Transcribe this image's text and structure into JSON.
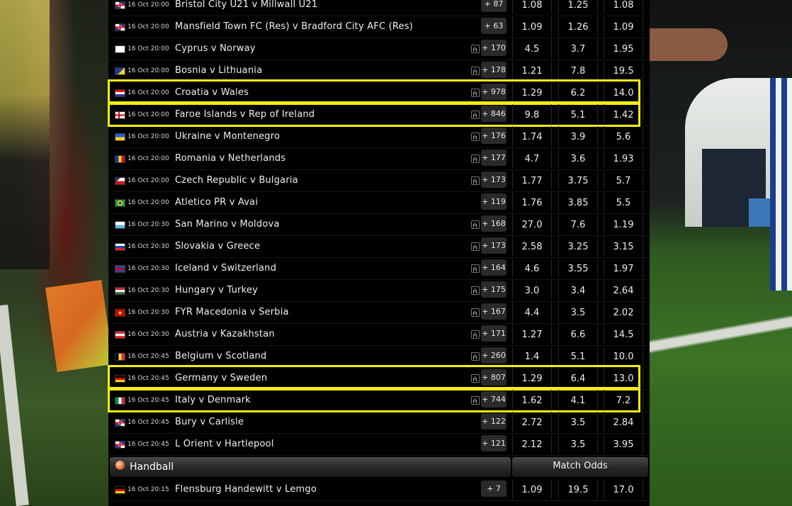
{
  "football_rows": [
    {
      "flag": "gb",
      "time": "16 Oct 20:00",
      "match": "Bristol City U21 v Millwall U21",
      "stats": false,
      "count": "+ 87",
      "odds": [
        "1.08",
        "1.25",
        "1.08"
      ]
    },
    {
      "flag": "gb",
      "time": "16 Oct 20:00",
      "match": "Mansfield Town FC (Res) v Bradford City AFC (Res)",
      "stats": false,
      "count": "+ 63",
      "odds": [
        "1.09",
        "1.26",
        "1.09"
      ]
    },
    {
      "flag": "cy",
      "time": "16 Oct 20:00",
      "match": "Cyprus v Norway",
      "stats": true,
      "count": "+ 170",
      "odds": [
        "4.5",
        "3.7",
        "1.95"
      ]
    },
    {
      "flag": "ba",
      "time": "16 Oct 20:00",
      "match": "Bosnia v Lithuania",
      "stats": true,
      "count": "+ 178",
      "odds": [
        "1.21",
        "7.8",
        "19.5"
      ]
    },
    {
      "flag": "hr",
      "time": "16 Oct 20:00",
      "match": "Croatia v Wales",
      "stats": true,
      "count": "+ 978",
      "odds": [
        "1.29",
        "6.2",
        "14.0"
      ],
      "highlight": true
    },
    {
      "flag": "fo",
      "time": "16 Oct 20:00",
      "match": "Faroe Islands v Rep of Ireland",
      "stats": true,
      "count": "+ 846",
      "odds": [
        "9.8",
        "5.1",
        "1.42"
      ],
      "highlight": true
    },
    {
      "flag": "ua",
      "time": "16 Oct 20:00",
      "match": "Ukraine v Montenegro",
      "stats": true,
      "count": "+ 176",
      "odds": [
        "1.74",
        "3.9",
        "5.6"
      ]
    },
    {
      "flag": "ro",
      "time": "16 Oct 20:00",
      "match": "Romania v Netherlands",
      "stats": true,
      "count": "+ 177",
      "odds": [
        "4.7",
        "3.6",
        "1.93"
      ]
    },
    {
      "flag": "cz",
      "time": "16 Oct 20:00",
      "match": "Czech Republic v Bulgaria",
      "stats": true,
      "count": "+ 173",
      "odds": [
        "1.77",
        "3.75",
        "5.7"
      ]
    },
    {
      "flag": "br",
      "time": "16 Oct 20:00",
      "match": "Atletico PR v Avai",
      "stats": false,
      "count": "+ 119",
      "odds": [
        "1.76",
        "3.85",
        "5.5"
      ]
    },
    {
      "flag": "sm",
      "time": "16 Oct 20:30",
      "match": "San Marino v Moldova",
      "stats": true,
      "count": "+ 168",
      "odds": [
        "27.0",
        "7.6",
        "1.19"
      ]
    },
    {
      "flag": "sk",
      "time": "16 Oct 20:30",
      "match": "Slovakia v Greece",
      "stats": true,
      "count": "+ 173",
      "odds": [
        "2.58",
        "3.25",
        "3.15"
      ]
    },
    {
      "flag": "is",
      "time": "16 Oct 20:30",
      "match": "Iceland v Switzerland",
      "stats": true,
      "count": "+ 164",
      "odds": [
        "4.6",
        "3.55",
        "1.97"
      ]
    },
    {
      "flag": "hu",
      "time": "16 Oct 20:30",
      "match": "Hungary v Turkey",
      "stats": true,
      "count": "+ 175",
      "odds": [
        "3.0",
        "3.4",
        "2.64"
      ]
    },
    {
      "flag": "mk",
      "time": "16 Oct 20:30",
      "match": "FYR Macedonia v Serbia",
      "stats": true,
      "count": "+ 167",
      "odds": [
        "4.4",
        "3.5",
        "2.02"
      ]
    },
    {
      "flag": "at",
      "time": "16 Oct 20:30",
      "match": "Austria v Kazakhstan",
      "stats": true,
      "count": "+ 171",
      "odds": [
        "1.27",
        "6.6",
        "14.5"
      ]
    },
    {
      "flag": "be",
      "time": "16 Oct 20:45",
      "match": "Belgium v Scotland",
      "stats": true,
      "count": "+ 260",
      "odds": [
        "1.4",
        "5.1",
        "10.0"
      ]
    },
    {
      "flag": "de",
      "time": "16 Oct 20:45",
      "match": "Germany v Sweden",
      "stats": true,
      "count": "+ 807",
      "odds": [
        "1.29",
        "6.4",
        "13.0"
      ],
      "highlight": true
    },
    {
      "flag": "it",
      "time": "16 Oct 20:45",
      "match": "Italy v Denmark",
      "stats": true,
      "count": "+ 744",
      "odds": [
        "1.62",
        "4.1",
        "7.2"
      ],
      "highlight": true
    },
    {
      "flag": "gb",
      "time": "16 Oct 20:45",
      "match": "Bury v Carlisle",
      "stats": false,
      "count": "+ 122",
      "odds": [
        "2.72",
        "3.5",
        "2.84"
      ]
    },
    {
      "flag": "gb",
      "time": "16 Oct 20:45",
      "match": "L Orient v Hartlepool",
      "stats": false,
      "count": "+ 121",
      "odds": [
        "2.12",
        "3.5",
        "3.95"
      ]
    }
  ],
  "handball_section": {
    "title": "Handball",
    "market": "Match Odds"
  },
  "handball_rows": [
    {
      "flag": "de",
      "time": "16 Oct 20:15",
      "match": "Flensburg Handewitt v Lemgo",
      "stats": false,
      "count": "+ 7",
      "odds": [
        "1.09",
        "19.5",
        "17.0"
      ]
    }
  ],
  "colors": {
    "highlight": "#f2ec16",
    "panel": "#000000"
  }
}
